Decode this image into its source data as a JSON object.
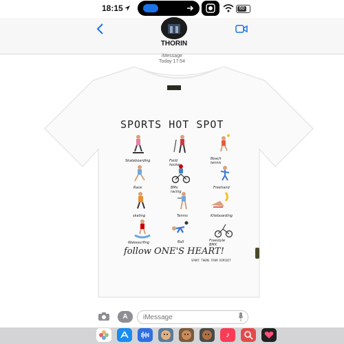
{
  "status_bar": {
    "time": "18:15",
    "battery": "60",
    "icons": [
      "location-arrow-icon",
      "arrow-icon",
      "screen-record-icon",
      "wifi-icon",
      "battery-icon"
    ]
  },
  "header": {
    "contact_name": "THORIN",
    "back_icon": "chevron-left-icon",
    "video_icon": "video-camera-icon"
  },
  "thread": {
    "service": "iMessage",
    "timestamp": "Today 17:54"
  },
  "message_image": {
    "title": "SPORTS HOT SPOT",
    "sports": [
      "Skateboarding",
      "Field hockey",
      "Beach tennis",
      "Race",
      "BMx racing",
      "Freehand",
      "skating",
      "Tennis",
      "Kiteboarding",
      "Wakesurfing",
      "Ball",
      "Freestyle BMX"
    ],
    "footer": "follow ONE'S HEART!",
    "small_print": "SPORT THEME FROM RIMIBIT"
  },
  "composer": {
    "placeholder": "iMessage",
    "camera_icon": "camera-icon",
    "apps_icon": "app-store-icon",
    "mic_icon": "microphone-icon"
  },
  "app_drawer": {
    "apps": [
      "photos-icon",
      "app-store-icon",
      "audio-icon",
      "memoji-icon",
      "memoji-icon",
      "memoji-icon",
      "music-icon",
      "search-images-icon",
      "heart-icon"
    ]
  },
  "colors": {
    "accent": "#1a73e8",
    "header_bg": "#f7f7f7",
    "drawer_bg": "#d4d4d7"
  }
}
